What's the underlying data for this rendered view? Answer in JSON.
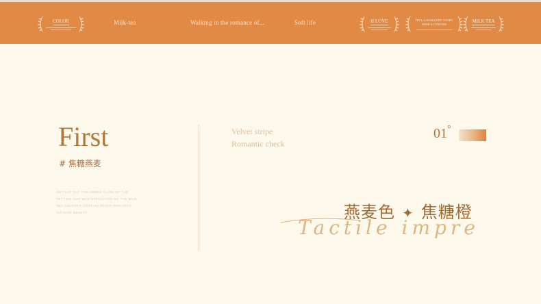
{
  "topbar": {
    "badges": [
      {
        "title": "COLOR"
      },
      {
        "title": "II LOVE"
      },
      {
        "title": "TELL A ROMANTIC STORY WITH A CURTAIN"
      },
      {
        "title": "MILK TEA"
      }
    ],
    "nav": [
      "Milk-tea",
      "Walking in the romance of...",
      "Soft life"
    ]
  },
  "main": {
    "title": "First",
    "subtitle": "# 焦糖燕麦",
    "small_text": "ON THAT DAY THE AMBER GLOW OF THE SETTING SUN WAS REFLECTED ON THE MILK TEA COLORED CURTAIN WHICH DIFFUSED INFINITE BEAUTY",
    "tags": [
      "Velvet stripe",
      "Romantic check"
    ],
    "number": "01",
    "degree": "°",
    "colors_cn": [
      "燕麦色",
      "焦糖橙"
    ],
    "star": "✦",
    "script": "Tactile impregian"
  },
  "colors": {
    "banner": "#e08a46",
    "background": "#fdf8ec",
    "accent": "#b0763a"
  }
}
